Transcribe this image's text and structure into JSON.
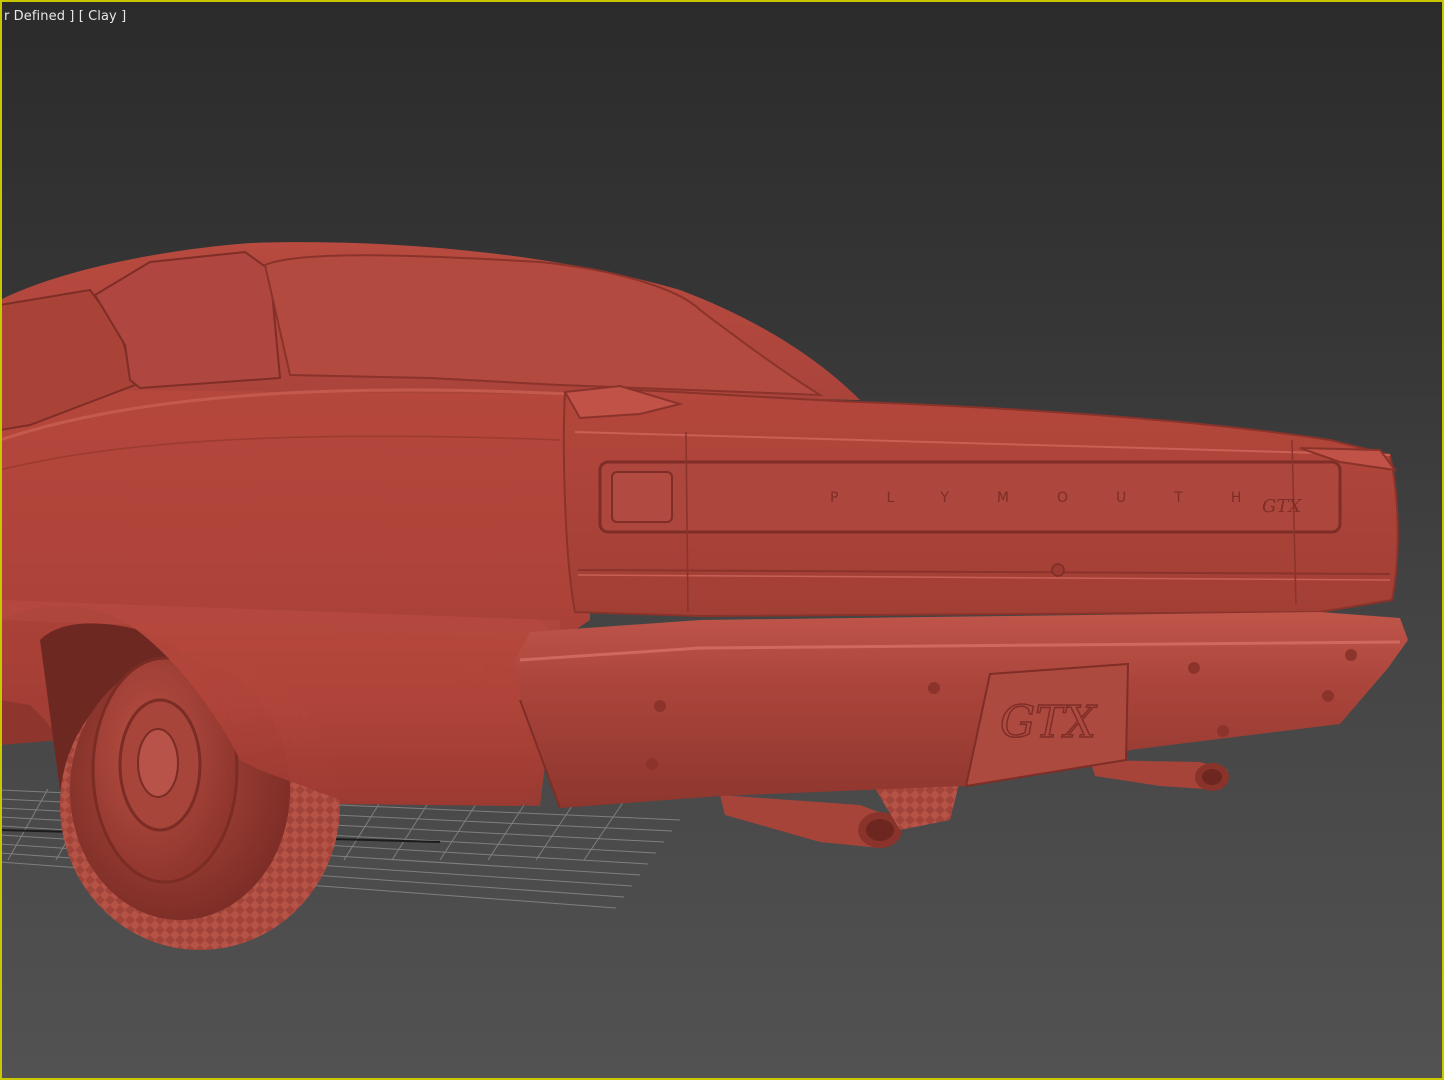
{
  "viewport": {
    "label_lighting": "r Defined ]",
    "label_shading": "[ Clay ]",
    "active_border_color": "#c8c800",
    "background_top": "#2b2b2b",
    "background_bottom": "#525252"
  },
  "scene": {
    "model_color": "#b5493d",
    "model_shadow_color": "#7e2e26",
    "model_highlight_color": "#c65a4b",
    "trunk_lettering": "PLYMOUTH",
    "trunk_badge": "GTX",
    "plate_text": "GTX",
    "grid_color": "#8c8c8c"
  }
}
